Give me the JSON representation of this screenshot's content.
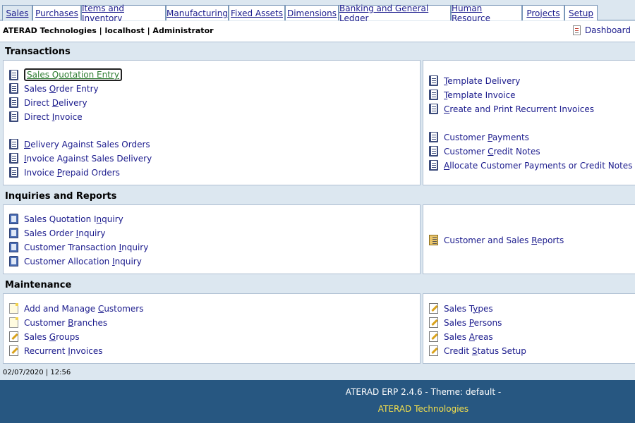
{
  "tabs": [
    {
      "label": "Sales",
      "active": true
    },
    {
      "label": "Purchases"
    },
    {
      "label": "Items and Inventory"
    },
    {
      "label": "Manufacturing"
    },
    {
      "label": "Fixed Assets"
    },
    {
      "label": "Dimensions"
    },
    {
      "label": "Banking and General Ledger"
    },
    {
      "label": "Human Resource"
    },
    {
      "label": "Projects"
    },
    {
      "label": "Setup"
    }
  ],
  "header": {
    "company_line": "ATERAD Technologies | localhost | Administrator",
    "dashboard_label": "Dashboard"
  },
  "sections": {
    "transactions": "Transactions",
    "inquiries": "Inquiries and Reports",
    "maintenance": "Maintenance"
  },
  "transactions": {
    "left": [
      {
        "pre": "",
        "u": "S",
        "post": "ales Quotation Entry",
        "selected": true
      },
      {
        "pre": "Sales ",
        "u": "O",
        "post": "rder Entry"
      },
      {
        "pre": "Direct ",
        "u": "D",
        "post": "elivery"
      },
      {
        "pre": "Direct ",
        "u": "I",
        "post": "nvoice"
      },
      {
        "pre": "",
        "u": "D",
        "post": "elivery Against Sales Orders"
      },
      {
        "pre": "",
        "u": "I",
        "post": "nvoice Against Sales Delivery"
      },
      {
        "pre": "Invoice ",
        "u": "P",
        "post": "repaid Orders"
      }
    ],
    "right": [
      {
        "pre": "",
        "u": "T",
        "post": "emplate Delivery"
      },
      {
        "pre": "",
        "u": "T",
        "post": "emplate Invoice"
      },
      {
        "pre": "",
        "u": "C",
        "post": "reate and Print Recurrent Invoices"
      },
      {
        "pre": "Customer ",
        "u": "P",
        "post": "ayments"
      },
      {
        "pre": "Customer ",
        "u": "C",
        "post": "redit Notes"
      },
      {
        "pre": "",
        "u": "A",
        "post": "llocate Customer Payments or Credit Notes"
      }
    ]
  },
  "inquiries": {
    "left": [
      {
        "pre": "Sales Quotation I",
        "u": "n",
        "post": "quiry"
      },
      {
        "pre": "Sales Order ",
        "u": "I",
        "post": "nquiry"
      },
      {
        "pre": "Customer Transaction ",
        "u": "I",
        "post": "nquiry"
      },
      {
        "pre": "Customer Allocation ",
        "u": "I",
        "post": "nquiry"
      }
    ],
    "right": [
      {
        "pre": "Customer and Sales ",
        "u": "R",
        "post": "eports"
      }
    ]
  },
  "maintenance": {
    "left": [
      {
        "pre": "Add and Manage ",
        "u": "C",
        "post": "ustomers"
      },
      {
        "pre": "Customer ",
        "u": "B",
        "post": "ranches"
      },
      {
        "pre": "Sales ",
        "u": "G",
        "post": "roups"
      },
      {
        "pre": "Recurrent ",
        "u": "I",
        "post": "nvoices"
      }
    ],
    "right": [
      {
        "pre": "Sales T",
        "u": "y",
        "post": "pes"
      },
      {
        "pre": "Sales ",
        "u": "P",
        "post": "ersons"
      },
      {
        "pre": "Sales ",
        "u": "A",
        "post": "reas"
      },
      {
        "pre": "Credit ",
        "u": "S",
        "post": "tatus Setup"
      }
    ]
  },
  "status": {
    "datetime": "02/07/2020 | 12:56"
  },
  "footer": {
    "version": "ATERAD ERP 2.4.6 - Theme: default -",
    "company": "ATERAD Technologies"
  },
  "icons": {
    "transactions": "book-icon",
    "inquiries": "binder-icon",
    "reports": "report-icon",
    "maintenance_page": "page-icon",
    "maintenance_edit": "edit-icon"
  },
  "colors": {
    "background": "#dce7f0",
    "link": "#1a1a8c",
    "footer_bg": "#275781",
    "footer_accent": "#f5e04b"
  }
}
